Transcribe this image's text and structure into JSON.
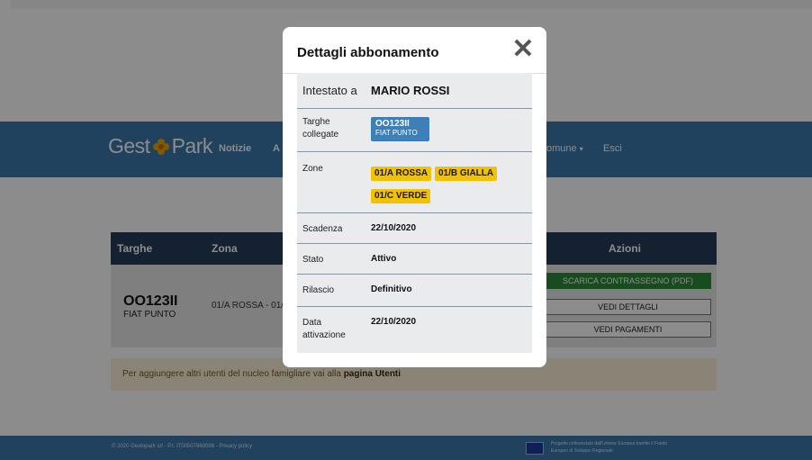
{
  "app": {
    "brand_left": "Gest",
    "brand_right": "Park",
    "nav": {
      "item1": "Notizie",
      "item2_partial": "A",
      "comune": "omune",
      "logout": "Esci"
    }
  },
  "table": {
    "headers": {
      "targhe": "Targhe",
      "zona": "Zona",
      "azioni": "Azioni"
    },
    "row": {
      "plate": "OO123II",
      "car": "FIAT PUNTO",
      "zones_partial": "01/A ROSSA - 01/"
    },
    "buttons": {
      "download": "SCARICA CONTRASSEGNO (PDF)",
      "details": "VEDI DETTAGLI",
      "payments": "VEDI PAGAMENTI"
    }
  },
  "info": {
    "text": "Per aggiungere altri utenti del nucleo famigliare vai alla ",
    "link": "pagina Utenti"
  },
  "footer": {
    "left": "© 2020 Gestopark srl - P.I. IT00507860096 - Privacy policy",
    "eu_line1": "Progetto cofinanziato dall'Unione Europea tramite il Fondo",
    "eu_line2": "Europeo di Sviluppo Regionale"
  },
  "modal": {
    "title": "Dettagli abbonamento",
    "close_symbol": "✕",
    "rows": {
      "intestato": {
        "label": "Intestato a",
        "value": "MARIO ROSSI"
      },
      "targhe": {
        "label_line1": "Targhe",
        "label_line2": "collegate",
        "plate": "OO123II",
        "car": "FIAT PUNTO"
      },
      "zone": {
        "label": "Zone",
        "chips": [
          "01/A ROSSA",
          "01/B GIALLA",
          "01/C VERDE"
        ]
      },
      "scadenza": {
        "label": "Scadenza",
        "value": "22/10/2020"
      },
      "stato": {
        "label": "Stato",
        "value": "Attivo"
      },
      "rilascio": {
        "label": "Rilascio",
        "value": "Definitivo"
      },
      "attivazione": {
        "label_line1": "Data",
        "label_line2": "attivazione",
        "value": "22/10/2020"
      }
    }
  },
  "colors": {
    "nav": "#3b78ad",
    "table_head": "#243d58",
    "zone_chip": "#f2c200",
    "plate_chip": "#3e7fb8",
    "download_button": "#2a8a3a"
  }
}
